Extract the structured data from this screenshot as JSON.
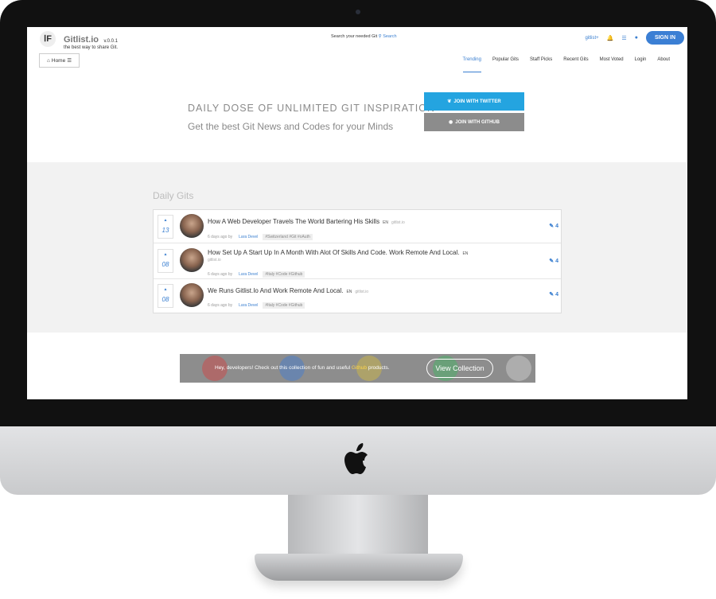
{
  "header": {
    "logo_glyph": "Ⅰ͏F",
    "brand_name": "Gitlist.io",
    "version": "v.0.0.1",
    "tagline": "the best way to share Git.",
    "search_text": "Search your needed Git",
    "search_link": "Search",
    "gitlist_plus": "gitlist+",
    "signin_label": "SIGN IN"
  },
  "nav": {
    "home_label": "Home",
    "items": [
      "Trending",
      "Popular Gits",
      "Staff Picks",
      "Recent Gits",
      "Most Voted",
      "Login",
      "About"
    ],
    "active": "Trending"
  },
  "hero": {
    "title": "DAILY DOSE OF UNLIMITED GIT INSPIRATION",
    "subtitle": "Get the best Git News and Codes for your Minds",
    "twitter_label": "JOIN WITH TWITTER",
    "github_label": "JOIN WITH GITHUB"
  },
  "daily": {
    "title": "Daily Gits",
    "items": [
      {
        "votes": "13",
        "title": "How A Web Developer Travels The World Bartering His Skills",
        "lang": "EN",
        "source": "gitlist.io",
        "time": "6 days ago by",
        "author": "Lara Devel",
        "tags": "#Switzerland #Git #oAuth",
        "comments": "4"
      },
      {
        "votes": "08",
        "title": "How Set Up A Start Up In A Month With Alot Of Skills And Code. Work Remote And Local.",
        "lang": "EN",
        "source": "gitlist.io",
        "time": "6 days ago by",
        "author": "Lara Devel",
        "tags": "#Italy #Code #Github",
        "comments": "4"
      },
      {
        "votes": "08",
        "title": "We Runs Gitlist.Io And Work Remote And Local.",
        "lang": "EN",
        "source": "gitlist.io",
        "time": "6 days ago by",
        "author": "Lara Devel",
        "tags": "#Italy #Code #Github",
        "comments": "4"
      }
    ]
  },
  "banner": {
    "text_before": "Hey, developers! Check out this collection of fun and useful",
    "brand": "Github",
    "text_after": "products.",
    "cta": "View Collection"
  },
  "colors": {
    "accent": "#3b7fd4",
    "twitter": "#24a4e0",
    "github": "#8c8c8c",
    "bg_section": "#f2f2f2"
  }
}
